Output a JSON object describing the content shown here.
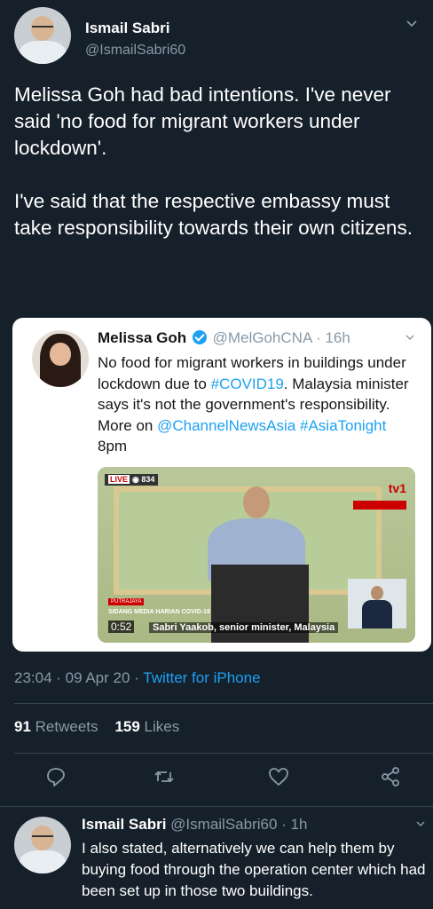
{
  "tweet": {
    "author_name": "Ismail Sabri",
    "author_handle": "@IsmailSabri60",
    "paragraph1": "Melissa Goh had bad intentions. I've never said 'no food for migrant workers under lockdown'.",
    "paragraph2": "I've said that the respective embassy must take responsibility towards their own citizens.",
    "time": "23:04 · 09 Apr 20 ·",
    "source": "Twitter for iPhone",
    "retweets_count": "91",
    "retweets_label": "Retweets",
    "likes_count": "159",
    "likes_label": "Likes"
  },
  "quoted": {
    "name": "Melissa Goh",
    "handle_time": "@MelGohCNA · 16h",
    "text_a": "No food for migrant workers in buildings under lockdown due to ",
    "hashtag1": "#COVID19",
    "text_b": ". Malaysia minister says it's not the government's responsibility. More on ",
    "mention": "@ChannelNewsAsia",
    "hashtag2": "#AsiaTonight",
    "text_c": " 8pm",
    "video": {
      "live_label": "LIVE",
      "viewers": "◉ 834",
      "channel_logo": "tv1",
      "location": "PUTRAJAYA",
      "subtitle": "SIDANG MEDIA HARIAN COVID-19",
      "duration": "0:52",
      "caption": "Sabri Yaakob, senior minister, Malaysia"
    }
  },
  "reply": {
    "name": "Ismail Sabri",
    "handle_time": "@IsmailSabri60 · 1h",
    "text": "I also stated, alternatively we can help them by buying food through the operation center which had been set up in those two buildings."
  },
  "icons": [
    "reply-icon",
    "retweet-icon",
    "like-icon",
    "share-icon",
    "chevron-down-icon",
    "verified-badge-icon"
  ],
  "colors": {
    "background": "#15202b",
    "accent": "#1da1f2",
    "muted": "#8899a6"
  }
}
